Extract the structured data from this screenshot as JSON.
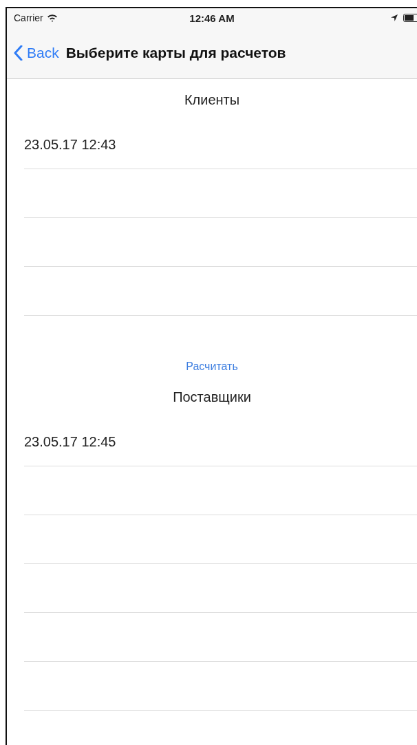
{
  "status_bar": {
    "carrier": "Carrier",
    "time": "12:46 AM"
  },
  "nav_bar": {
    "back": "Back",
    "title": "Выберите карты для расчетов"
  },
  "sections": [
    {
      "kind": "list",
      "header": "Клиенты",
      "rows": [
        {
          "text": "23.05.17 12:43"
        }
      ]
    },
    {
      "kind": "button",
      "label": "Расчитать"
    },
    {
      "kind": "list",
      "header": "Поставщики",
      "rows": [
        {
          "text": "23.05.17 12:45"
        }
      ]
    }
  ]
}
